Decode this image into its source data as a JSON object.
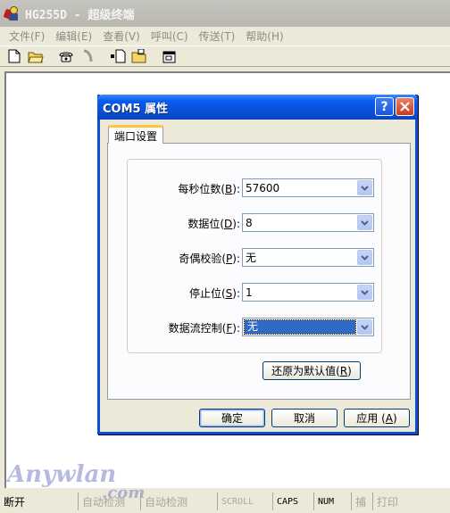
{
  "window": {
    "title": "HG255D - 超级终端",
    "menu": [
      "文件(F)",
      "编辑(E)",
      "查看(V)",
      "呼叫(C)",
      "传送(T)",
      "帮助(H)"
    ]
  },
  "status": {
    "connection": "断开",
    "detect1": "自动检测",
    "detect2": "自动检测",
    "scroll": "SCROLL",
    "caps": "CAPS",
    "num": "NUM",
    "capture": "捕",
    "print": "打印"
  },
  "watermark": {
    "text": "Anywlan",
    "sub": ".com"
  },
  "dialog": {
    "title": "COM5 属性",
    "tab": "端口设置",
    "fields": [
      {
        "label": "每秒位数",
        "key": "B",
        "value": "57600"
      },
      {
        "label": "数据位",
        "key": "D",
        "value": "8"
      },
      {
        "label": "奇偶校验",
        "key": "P",
        "value": "无"
      },
      {
        "label": "停止位",
        "key": "S",
        "value": "1"
      },
      {
        "label": "数据流控制",
        "key": "F",
        "value": "无"
      }
    ],
    "restore_label": "还原为默认值",
    "restore_key": "R",
    "ok_label": "确定",
    "cancel_label": "取消",
    "apply_label": "应用",
    "apply_key": "A"
  },
  "colors": {
    "title_active": "#0a4fd4",
    "close_button": "#cc3a1c",
    "selection": "#316ac5",
    "disabled_text": "#8d8c86"
  }
}
